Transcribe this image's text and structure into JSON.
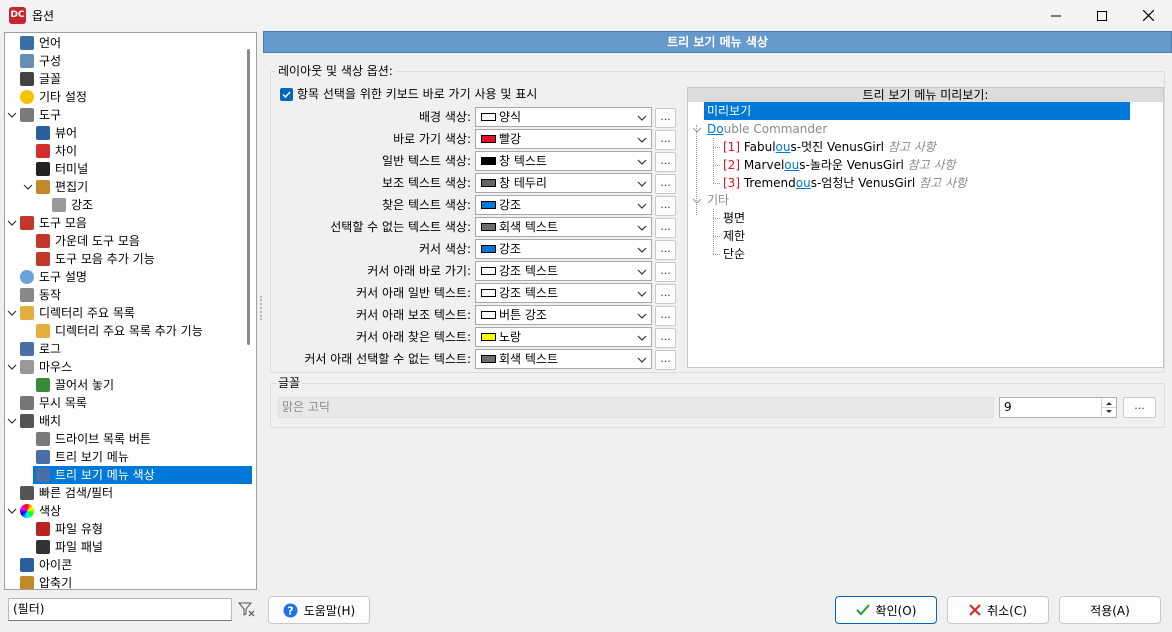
{
  "window": {
    "title": "옵션"
  },
  "tree": {
    "items": [
      {
        "label": "언어",
        "icon": "flag-icon"
      },
      {
        "label": "구성",
        "icon": "config-icon"
      },
      {
        "label": "글꼴",
        "icon": "font-icon"
      },
      {
        "label": "기타 설정",
        "icon": "smiley-icon"
      },
      {
        "label": "도구",
        "icon": "tools-icon"
      },
      {
        "label": "뷰어",
        "icon": "book-icon"
      },
      {
        "label": "차이",
        "icon": "diff-icon"
      },
      {
        "label": "터미널",
        "icon": "terminal-icon"
      },
      {
        "label": "편집기",
        "icon": "editor-icon"
      },
      {
        "label": "강조",
        "icon": "document-icon"
      },
      {
        "label": "도구 모음",
        "icon": "scissors-icon"
      },
      {
        "label": "가운데 도구 모음",
        "icon": "scissors-icon"
      },
      {
        "label": "도구 모음 추가 기능",
        "icon": "scissors-icon"
      },
      {
        "label": "도구 설명",
        "icon": "lightbulb-icon"
      },
      {
        "label": "동작",
        "icon": "gear-doc-icon"
      },
      {
        "label": "디렉터리 주요 목록",
        "icon": "folder-icon"
      },
      {
        "label": "디렉터리 주요 목록 추가 기능",
        "icon": "folder-icon"
      },
      {
        "label": "로그",
        "icon": "log-icon"
      },
      {
        "label": "마우스",
        "icon": "mouse-icon"
      },
      {
        "label": "끌어서 놓기",
        "icon": "drag-icon"
      },
      {
        "label": "무시 목록",
        "icon": "ignore-icon"
      },
      {
        "label": "배치",
        "icon": "layout-icon"
      },
      {
        "label": "드라이브 목록 버튼",
        "icon": "drive-icon"
      },
      {
        "label": "트리 보기 메뉴",
        "icon": "treeview-icon"
      },
      {
        "label": "트리 보기 메뉴 색상",
        "icon": "treeview-color-icon"
      },
      {
        "label": "빠른 검색/필터",
        "icon": "binoculars-icon"
      },
      {
        "label": "색상",
        "icon": "color-wheel-icon"
      },
      {
        "label": "파일 유형",
        "icon": "filetype-icon"
      },
      {
        "label": "파일 패널",
        "icon": "panel-icon"
      },
      {
        "label": "아이콘",
        "icon": "footprint-icon"
      },
      {
        "label": "압축기",
        "icon": "archive-icon"
      }
    ],
    "selected_index": 24
  },
  "filter": {
    "value": "(필터)"
  },
  "header": {
    "title": "트리 보기 메뉴 색상"
  },
  "layout_group": {
    "title": "레이아웃 및 색상 옵션:",
    "checkbox_label": "항목 선택을 위한 키보드 바로 가기 사용 및 표시",
    "checked": true,
    "rows": [
      {
        "label": "배경 색상:",
        "value": "양식",
        "color": "#ffffff"
      },
      {
        "label": "바로 가기 색상:",
        "value": "빨강",
        "color": "#e81123"
      },
      {
        "label": "일반 텍스트 색상:",
        "value": "창 텍스트",
        "color": "#000000"
      },
      {
        "label": "보조 텍스트 색상:",
        "value": "창 테두리",
        "color": "#646464"
      },
      {
        "label": "찾은 텍스트 색상:",
        "value": "강조",
        "color": "#0078d7"
      },
      {
        "label": "선택할 수 없는 텍스트 색상:",
        "value": "회색 텍스트",
        "color": "#6d6d6d"
      },
      {
        "label": "커서 색상:",
        "value": "강조",
        "color": "#0078d7"
      },
      {
        "label": "커서 아래 바로 가기:",
        "value": "강조 텍스트",
        "color": "#ffffff"
      },
      {
        "label": "커서 아래 일반 텍스트:",
        "value": "강조 텍스트",
        "color": "#ffffff"
      },
      {
        "label": "커서 아래 보조 텍스트:",
        "value": "버튼 강조",
        "color": "#ffffff"
      },
      {
        "label": "커서 아래 찾은 텍스트:",
        "value": "노랑",
        "color": "#ffff00"
      },
      {
        "label": "커서 아래 선택할 수 없는 텍스트:",
        "value": "회색 텍스트",
        "color": "#6d6d6d"
      }
    ],
    "dots_label": "..."
  },
  "preview": {
    "title": "트리 보기 메뉴 미리보기:",
    "selected": "미리보기",
    "group1": {
      "prefix": "Do",
      "rest": "uble Commander"
    },
    "items": [
      {
        "key": "[1]",
        "pre": "Fabul",
        "hl": "ou",
        "post": "s-멋진 VenusGirl",
        "note": "참고 사항"
      },
      {
        "key": "[2]",
        "pre": "Marvel",
        "hl": "ou",
        "post": "s-놀라운 VenusGirl",
        "note": "참고 사항"
      },
      {
        "key": "[3]",
        "pre": "Tremend",
        "hl": "ou",
        "post": "s-엄청난 VenusGirl",
        "note": "참고 사항"
      }
    ],
    "group2": "기타",
    "group2_items": [
      "평면",
      "제한",
      "단순"
    ]
  },
  "font_group": {
    "title": "글꼴",
    "font_name": "맑은 고딕",
    "size": "9",
    "dots_label": "..."
  },
  "buttons": {
    "help": "도움말(H)",
    "ok": "확인(O)",
    "cancel": "취소(C)",
    "apply": "적용(A)"
  }
}
